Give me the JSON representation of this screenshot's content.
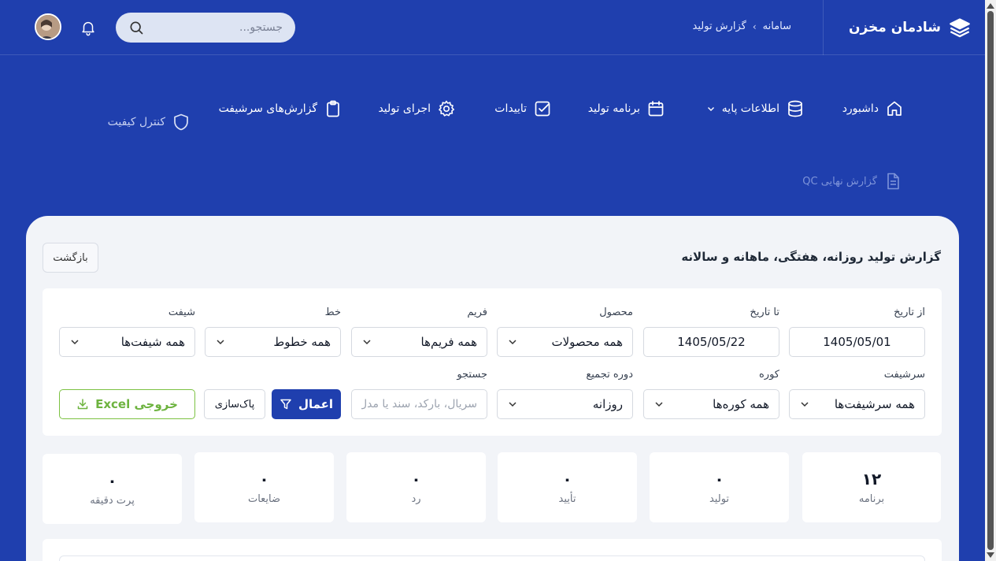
{
  "header": {
    "brand": "شادمان مخزن",
    "breadcrumb": [
      "سامانه",
      "گزارش تولید"
    ],
    "breadcrumb_sep": "›",
    "search_placeholder": "جستجو..."
  },
  "nav": {
    "items": [
      {
        "label": "داشبورد"
      },
      {
        "label": "اطلاعات پایه"
      },
      {
        "label": "برنامه تولید"
      },
      {
        "label": "تاییدات"
      },
      {
        "label": "اجرای تولید"
      },
      {
        "label": "گزارش‌های سرشیفت"
      },
      {
        "label": "کنترل کیفیت"
      },
      {
        "label": "گزارش نهایی QC"
      }
    ]
  },
  "page": {
    "title": "گزارش تولید روزانه، هفتگی، ماهانه و سالانه",
    "back_label": "بازگشت"
  },
  "filters": {
    "from_date": {
      "label": "از تاریخ",
      "value": "1405/05/01"
    },
    "to_date": {
      "label": "تا تاریخ",
      "value": "1405/05/22"
    },
    "product": {
      "label": "محصول",
      "value": "همه محصولات"
    },
    "frame": {
      "label": "فریم",
      "value": "همه فریم‌ها"
    },
    "line": {
      "label": "خط",
      "value": "همه خطوط"
    },
    "shift": {
      "label": "شیفت",
      "value": "همه شیفت‌ها"
    },
    "supervisor_shift": {
      "label": "سرشیفت",
      "value": "همه سرشیفت‌ها"
    },
    "furnace": {
      "label": "کوره",
      "value": "همه کوره‌ها"
    },
    "period": {
      "label": "دوره تجمیع",
      "value": "روزانه"
    },
    "search": {
      "label": "جستجو",
      "placeholder": "سریال، بارکد، سند یا مدل"
    },
    "apply_label": "اعمال",
    "clear_label": "پاک‌سازی",
    "excel_label": "خروجی Excel"
  },
  "stats": [
    {
      "label": "برنامه",
      "value": "۱۲"
    },
    {
      "label": "تولید",
      "value": "۰"
    },
    {
      "label": "تأیید",
      "value": "۰"
    },
    {
      "label": "رد",
      "value": "۰"
    },
    {
      "label": "ضایعات",
      "value": "۰"
    },
    {
      "label": "پرت دقیقه",
      "value": "۰"
    }
  ],
  "colors": {
    "primary": "#1f3fae",
    "excel_green": "#6db33f",
    "background": "#f2f4f8"
  }
}
